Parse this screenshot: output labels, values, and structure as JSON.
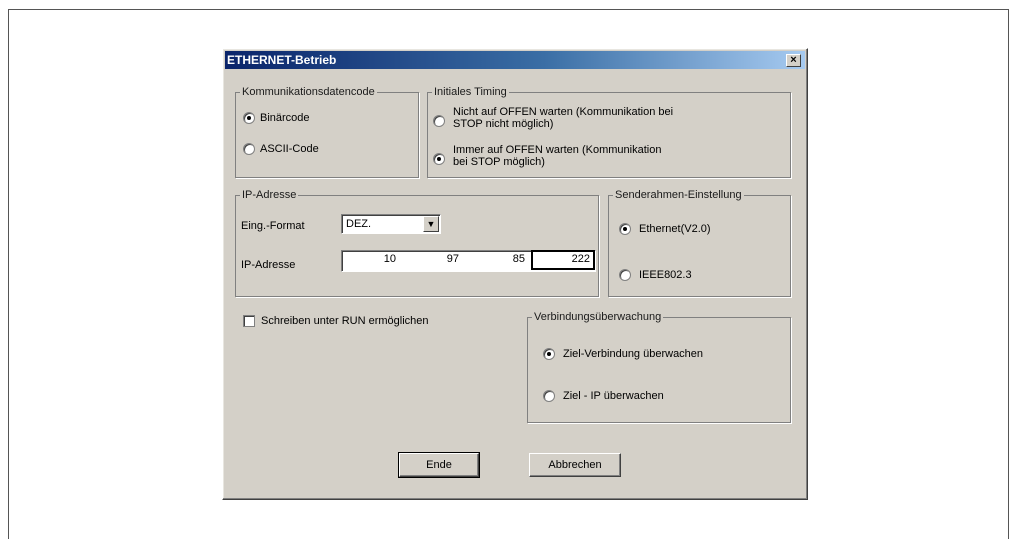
{
  "dialog": {
    "title": "ETHERNET-Betrieb",
    "close_glyph": "×"
  },
  "comm_code": {
    "legend": "Kommunikationsdatencode",
    "options": [
      {
        "label": "Binärcode",
        "checked": true
      },
      {
        "label": "ASCII-Code",
        "checked": false
      }
    ]
  },
  "timing": {
    "legend": "Initiales Timing",
    "options": [
      {
        "line1": "Nicht auf OFFEN warten (Kommunikation bei",
        "line2": "STOP nicht möglich)",
        "checked": false
      },
      {
        "line1": "Immer auf OFFEN warten (Kommunikation",
        "line2": "bei STOP möglich)",
        "checked": true
      }
    ]
  },
  "ip": {
    "legend": "IP-Adresse",
    "format_label": "Eing.-Format",
    "format_value": "DEZ.",
    "address_label": "IP-Adresse",
    "segments": [
      "10",
      "97",
      "85",
      "222"
    ]
  },
  "frame": {
    "legend": "Senderahmen-Einstellung",
    "options": [
      {
        "label": "Ethernet(V2.0)",
        "checked": true
      },
      {
        "label": "IEEE802.3",
        "checked": false
      }
    ]
  },
  "run_write": {
    "label": "Schreiben unter RUN ermöglichen",
    "checked": false
  },
  "monitor": {
    "legend": "Verbindungsüberwachung",
    "options": [
      {
        "label": "Ziel-Verbindung überwachen",
        "checked": true
      },
      {
        "label": "Ziel - IP überwachen",
        "checked": false
      }
    ]
  },
  "buttons": {
    "ok": "Ende",
    "cancel": "Abbrechen"
  },
  "icons": {
    "combo_arrow": "chevron-down-icon"
  }
}
